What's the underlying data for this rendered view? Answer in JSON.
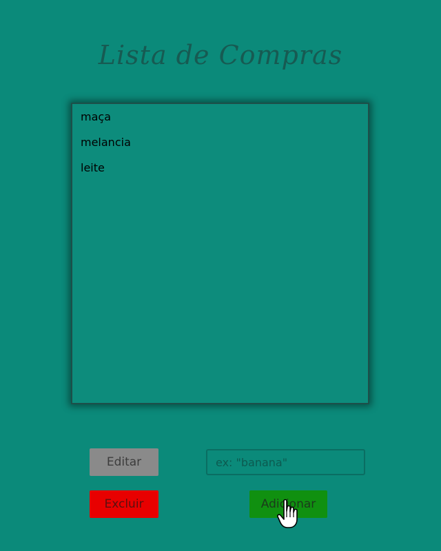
{
  "header": {
    "title": "Lista de Compras"
  },
  "list": {
    "items": [
      "maça",
      "melancia",
      "leite"
    ]
  },
  "form": {
    "edit_label": "Editar",
    "delete_label": "Excluir",
    "add_label": "Adicionar",
    "input_placeholder": "ex: \"banana\"",
    "input_value": ""
  },
  "colors": {
    "background": "#0b8a7a",
    "edit": "#8a8a8a",
    "delete": "#e80000",
    "add": "#109010"
  },
  "icons": {
    "pointer": "hand-pointer-icon"
  }
}
